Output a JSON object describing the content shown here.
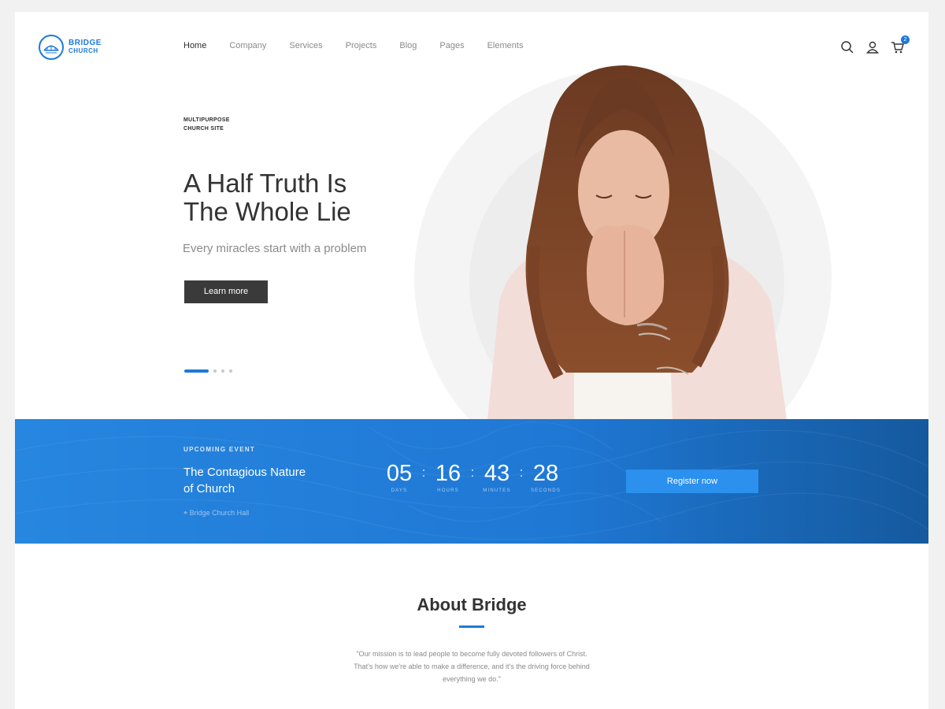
{
  "logo": {
    "line1": "BRIDGE",
    "line2": "CHURCH",
    "icon": "bridge-icon"
  },
  "nav": {
    "items": [
      "Home",
      "Company",
      "Services",
      "Projects",
      "Blog",
      "Pages",
      "Elements"
    ],
    "active": "Home"
  },
  "header_icons": {
    "search": "search-icon",
    "account": "user-icon",
    "cart": "cart-icon",
    "cart_count": "2"
  },
  "hero": {
    "eyebrow_line1": "MULTIPURPOSE",
    "eyebrow_line2": "CHURCH SITE",
    "title_line1": "A Half Truth Is",
    "title_line2": "The Whole Lie",
    "subtitle": "Every miracles start with a problem",
    "cta": "Learn more",
    "slide_count": 4,
    "active_slide": 1
  },
  "event": {
    "label": "UPCOMING EVENT",
    "title_line1": "The Contagious Nature",
    "title_line2": "of Church",
    "location": "Bridge Church Hall",
    "countdown": [
      {
        "value": "05",
        "label": "DAYS"
      },
      {
        "value": "16",
        "label": "HOURS"
      },
      {
        "value": "43",
        "label": "MINUTES"
      },
      {
        "value": "28",
        "label": "SECONDS"
      }
    ],
    "register": "Register now"
  },
  "about": {
    "title": "About Bridge",
    "text_line1": "\"Our mission is to lead people to become fully devoted followers of Christ.",
    "text_line2": "That's how we're able to make a difference, and it's the driving force behind",
    "text_line3": "everything we do.\""
  },
  "colors": {
    "accent": "#1e79d6",
    "dark_button": "#3a3a3a",
    "band_start": "#2786df",
    "band_end": "#15599e"
  }
}
